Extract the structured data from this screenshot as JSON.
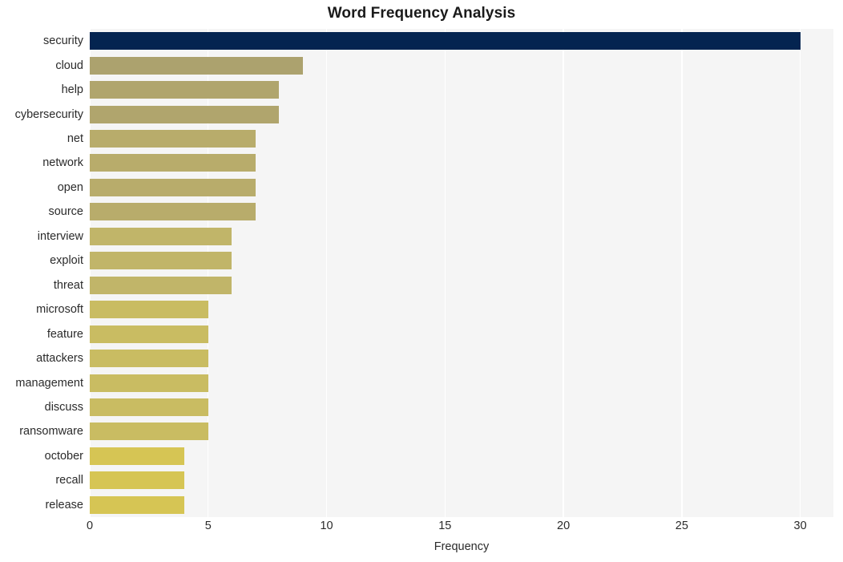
{
  "chart_data": {
    "type": "bar",
    "orientation": "horizontal",
    "title": "Word Frequency Analysis",
    "xlabel": "Frequency",
    "ylabel": "",
    "categories": [
      "security",
      "cloud",
      "help",
      "cybersecurity",
      "net",
      "network",
      "open",
      "source",
      "interview",
      "exploit",
      "threat",
      "microsoft",
      "feature",
      "attackers",
      "management",
      "discuss",
      "ransomware",
      "october",
      "recall",
      "release"
    ],
    "values": [
      30,
      9,
      8,
      8,
      7,
      7,
      7,
      7,
      6,
      6,
      6,
      5,
      5,
      5,
      5,
      5,
      5,
      4,
      4,
      4
    ],
    "xlim": [
      0,
      31.4
    ],
    "xticks": [
      0,
      5,
      10,
      15,
      20,
      25,
      30
    ],
    "xtick_labels": [
      "0",
      "5",
      "10",
      "15",
      "20",
      "25",
      "30"
    ],
    "grid": "vertical-only",
    "legend": "none",
    "bar_colors": [
      "#042450",
      "#aca26e",
      "#b0a56d",
      "#b0a56d",
      "#b8ac6b",
      "#b8ac6b",
      "#b8ac6b",
      "#b8ac6b",
      "#c1b569",
      "#c1b569",
      "#c1b569",
      "#c9bc62",
      "#c9bc62",
      "#c9bc62",
      "#c9bc62",
      "#c9bc62",
      "#c9bc62",
      "#d6c554",
      "#d6c554",
      "#d6c554"
    ],
    "colors": {
      "plot_background": "#f5f5f5",
      "figure_background": "#ffffff",
      "gridline": "#ffffff",
      "title_text": "#1a1a1a",
      "tick_text": "#2b2b2b",
      "highlight_bar": "#042450"
    }
  }
}
